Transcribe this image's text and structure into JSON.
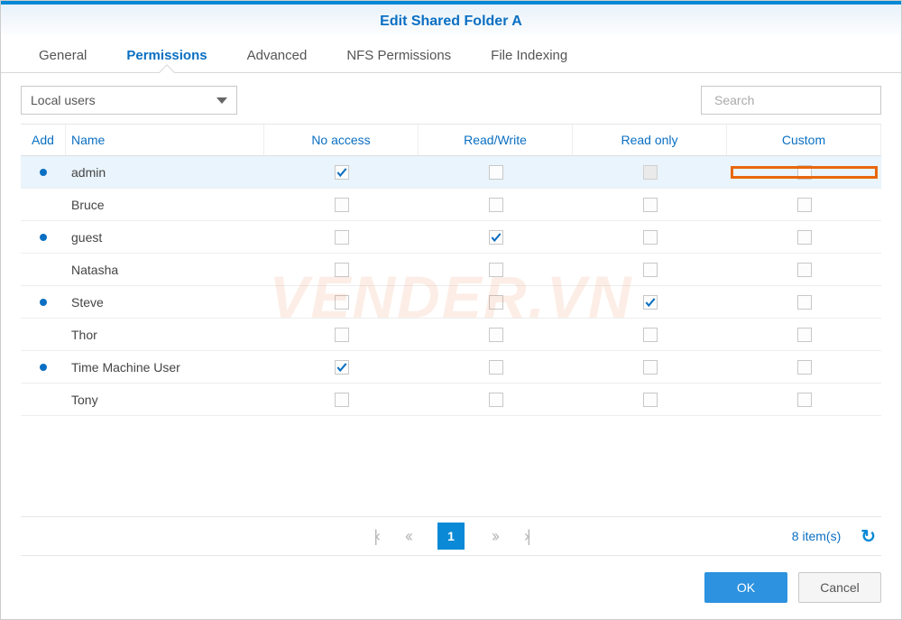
{
  "title": "Edit Shared Folder A",
  "tabs": [
    {
      "label": "General"
    },
    {
      "label": "Permissions",
      "active": true
    },
    {
      "label": "Advanced"
    },
    {
      "label": "NFS Permissions"
    },
    {
      "label": "File Indexing"
    }
  ],
  "user_scope": "Local users",
  "search_placeholder": "Search",
  "columns": {
    "add": "Add",
    "name": "Name",
    "no_access": "No access",
    "read_write": "Read/Write",
    "read_only": "Read only",
    "custom": "Custom"
  },
  "rows": [
    {
      "name": "admin",
      "bullet": true,
      "no_access": true,
      "read_write": false,
      "read_only": "disabled",
      "custom": false,
      "highlight": "custom",
      "selected": true
    },
    {
      "name": "Bruce",
      "bullet": false,
      "no_access": false,
      "read_write": false,
      "read_only": false,
      "custom": false
    },
    {
      "name": "guest",
      "bullet": true,
      "no_access": false,
      "read_write": true,
      "read_only": false,
      "custom": false
    },
    {
      "name": "Natasha",
      "bullet": false,
      "no_access": false,
      "read_write": false,
      "read_only": false,
      "custom": false
    },
    {
      "name": "Steve",
      "bullet": true,
      "no_access": false,
      "read_write": false,
      "read_only": true,
      "custom": false
    },
    {
      "name": "Thor",
      "bullet": false,
      "no_access": false,
      "read_write": false,
      "read_only": false,
      "custom": false
    },
    {
      "name": "Time Machine User",
      "bullet": true,
      "no_access": true,
      "read_write": false,
      "read_only": false,
      "custom": false
    },
    {
      "name": "Tony",
      "bullet": false,
      "no_access": false,
      "read_write": false,
      "read_only": false,
      "custom": false
    }
  ],
  "pager": {
    "page": "1",
    "summary": "8 item(s)"
  },
  "buttons": {
    "ok": "OK",
    "cancel": "Cancel"
  },
  "watermark": "VENDER.VN"
}
